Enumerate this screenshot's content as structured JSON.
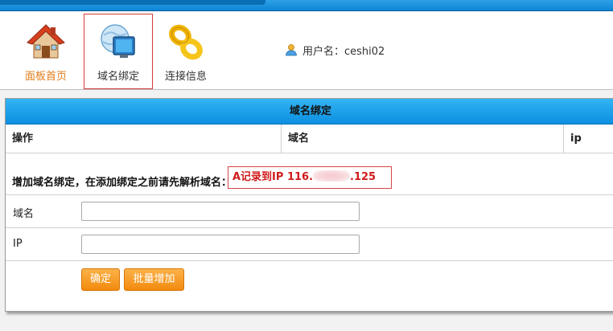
{
  "toolbar": {
    "items": [
      {
        "label": "面板首页",
        "icon": "house-icon"
      },
      {
        "label": "域名绑定",
        "icon": "globe-monitor-icon"
      },
      {
        "label": "连接信息",
        "icon": "chain-link-icon"
      }
    ],
    "user_label": "用户名：ceshi02"
  },
  "panel": {
    "title": "域名绑定",
    "columns": [
      "操作",
      "域名",
      "ip"
    ],
    "notice_text": "增加域名绑定，在添加绑定之前请先解析域名：",
    "notice_highlight_prefix": "A记录到IP 116.",
    "notice_highlight_suffix": ".125",
    "fields": [
      {
        "label": "域名",
        "value": "",
        "placeholder": ""
      },
      {
        "label": "IP",
        "value": "",
        "placeholder": ""
      }
    ],
    "buttons": {
      "confirm": "确定",
      "batch": "批量增加"
    }
  },
  "colors": {
    "header_blue": "#0b8fe0",
    "accent_orange": "#f28a0d",
    "notice_red": "#d11b1b",
    "active_border": "#d63a3a"
  }
}
